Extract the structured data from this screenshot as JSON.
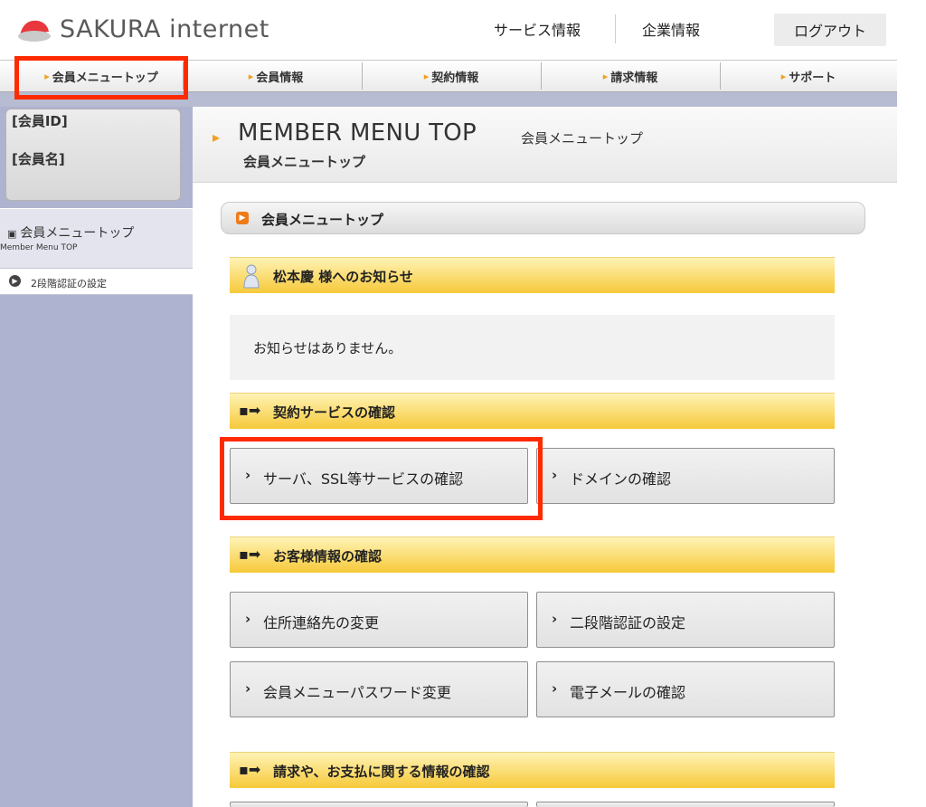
{
  "header": {
    "logo_text": "SAKURA internet",
    "nav": [
      "サービス情報",
      "企業情報"
    ],
    "logout_label": "ログアウト"
  },
  "tabs": [
    "会員メニュートップ",
    "会員情報",
    "契約情報",
    "請求情報",
    "サポート"
  ],
  "sidebar": {
    "member_id_label": "[会員ID]",
    "member_name_label": "[会員名]",
    "menu_top_label": "会員メニュートップ",
    "menu_top_sub": "Member Menu TOP",
    "two_factor_label": "2段階認証の設定"
  },
  "page": {
    "title_en": "MEMBER MENU TOP",
    "title_jp": "会員メニュートップ",
    "title_jp_sub": "会員メニュートップ",
    "breadcrumb": "会員メニュートップ"
  },
  "notice": {
    "heading": "松本慶 様へのお知らせ",
    "body": "お知らせはありません。"
  },
  "sections": {
    "contract": {
      "heading": "契約サービスの確認",
      "buttons": [
        "サーバ、SSL等サービスの確認",
        "ドメインの確認"
      ]
    },
    "customer": {
      "heading": "お客様情報の確認",
      "buttons": [
        "住所連絡先の変更",
        "二段階認証の設定",
        "会員メニューパスワード変更",
        "電子メールの確認"
      ]
    },
    "billing": {
      "heading": "請求や、お支払に関する情報の確認"
    }
  },
  "colors": {
    "highlight": "#ff2a00",
    "section_gradient": "#f6c93a",
    "sidebar_bg": "#aeb3cf",
    "logo_red": "#e8383d"
  }
}
